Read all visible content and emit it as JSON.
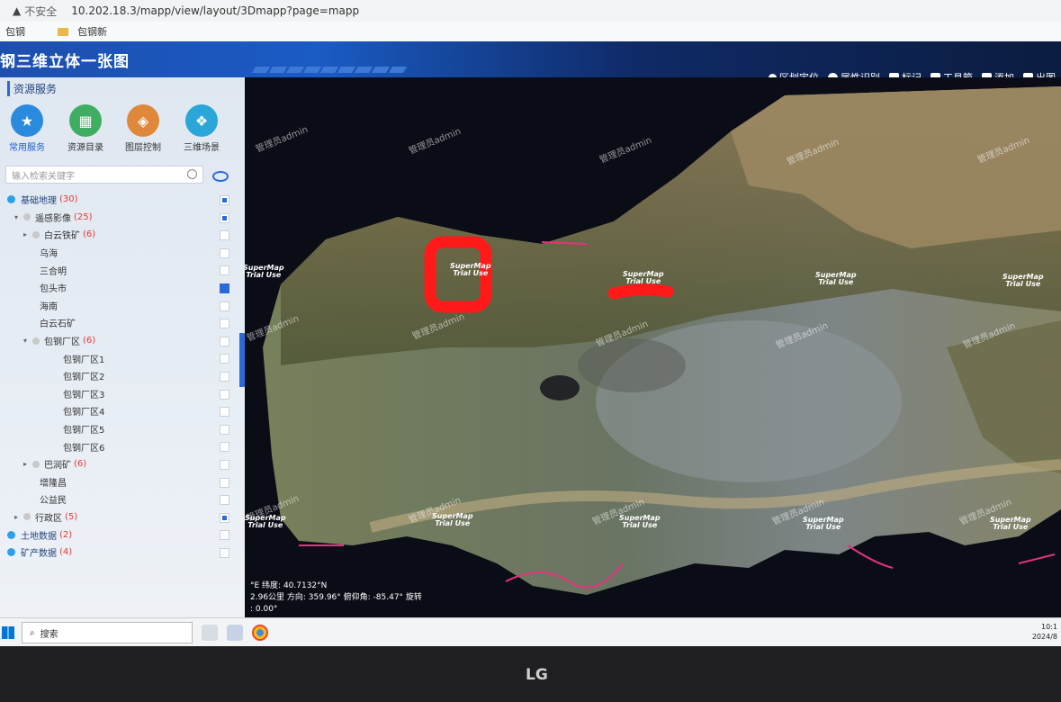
{
  "browser": {
    "security_label": "不安全",
    "url": "10.202.18.3/mapp/view/layout/3Dmapp?page=mapp",
    "bookmarks": [
      "包钢",
      "包钢新"
    ]
  },
  "app": {
    "title": "钢三维立体一张图"
  },
  "toolbar": {
    "items": [
      "区划定位",
      "属性识别",
      "标记",
      "工具箱",
      "添加",
      "出图"
    ]
  },
  "sidebar": {
    "section_title": "资源服务",
    "services": [
      {
        "label": "常用服务",
        "icon": "star-icon",
        "color": "#2a8bde"
      },
      {
        "label": "资源目录",
        "icon": "grid-icon",
        "color": "#3fae62"
      },
      {
        "label": "图层控制",
        "icon": "layers-icon",
        "color": "#e0883a"
      },
      {
        "label": "三维场景",
        "icon": "cube-icon",
        "color": "#2aa6d8"
      }
    ],
    "search_placeholder": "输入检索关键字",
    "tree": [
      {
        "label": "基础地理",
        "count": "(30)",
        "level": 0,
        "state": "half"
      },
      {
        "label": "遥感影像",
        "count": "(25)",
        "level": 1,
        "state": "half"
      },
      {
        "label": "白云铁矿",
        "count": "(6)",
        "level": 2,
        "state": "off"
      },
      {
        "label": "乌海",
        "count": "",
        "level": 3,
        "state": "off"
      },
      {
        "label": "三合明",
        "count": "",
        "level": 3,
        "state": "off"
      },
      {
        "label": "包头市",
        "count": "",
        "level": 3,
        "state": "on"
      },
      {
        "label": "海南",
        "count": "",
        "level": 3,
        "state": "off"
      },
      {
        "label": "白云石矿",
        "count": "",
        "level": 3,
        "state": "off"
      },
      {
        "label": "包钢厂区",
        "count": "(6)",
        "level": 2,
        "state": "off"
      },
      {
        "label": "包钢厂区1",
        "count": "",
        "level": 4,
        "state": "off"
      },
      {
        "label": "包钢厂区2",
        "count": "",
        "level": 4,
        "state": "off"
      },
      {
        "label": "包钢厂区3",
        "count": "",
        "level": 4,
        "state": "off"
      },
      {
        "label": "包钢厂区4",
        "count": "",
        "level": 4,
        "state": "off"
      },
      {
        "label": "包钢厂区5",
        "count": "",
        "level": 4,
        "state": "off"
      },
      {
        "label": "包钢厂区6",
        "count": "",
        "level": 4,
        "state": "off"
      },
      {
        "label": "巴润矿",
        "count": "(6)",
        "level": 2,
        "state": "off"
      },
      {
        "label": "增隆昌",
        "count": "",
        "level": 3,
        "state": "off"
      },
      {
        "label": "公益民",
        "count": "",
        "level": 3,
        "state": "off"
      },
      {
        "label": "行政区",
        "count": "(5)",
        "level": 1,
        "state": "half"
      },
      {
        "label": "土地数据",
        "count": "(2)",
        "level": 0,
        "state": "off"
      },
      {
        "label": "矿产数据",
        "count": "(4)",
        "level": 0,
        "state": "off"
      }
    ]
  },
  "map": {
    "watermark": "管理员admin",
    "brand_top": "SuperMap",
    "brand_bottom": "Trial Use",
    "status": {
      "line1": "°E  纬度: 40.7132°N",
      "line2": "2.96公里  方向: 359.96°  俯仰角: -85.47°  旋转",
      "line3": ": 0.00°"
    }
  },
  "taskbar": {
    "search_label": "搜索",
    "clock_time": "10:1",
    "clock_date": "2024/8"
  },
  "monitor_brand": "LG"
}
